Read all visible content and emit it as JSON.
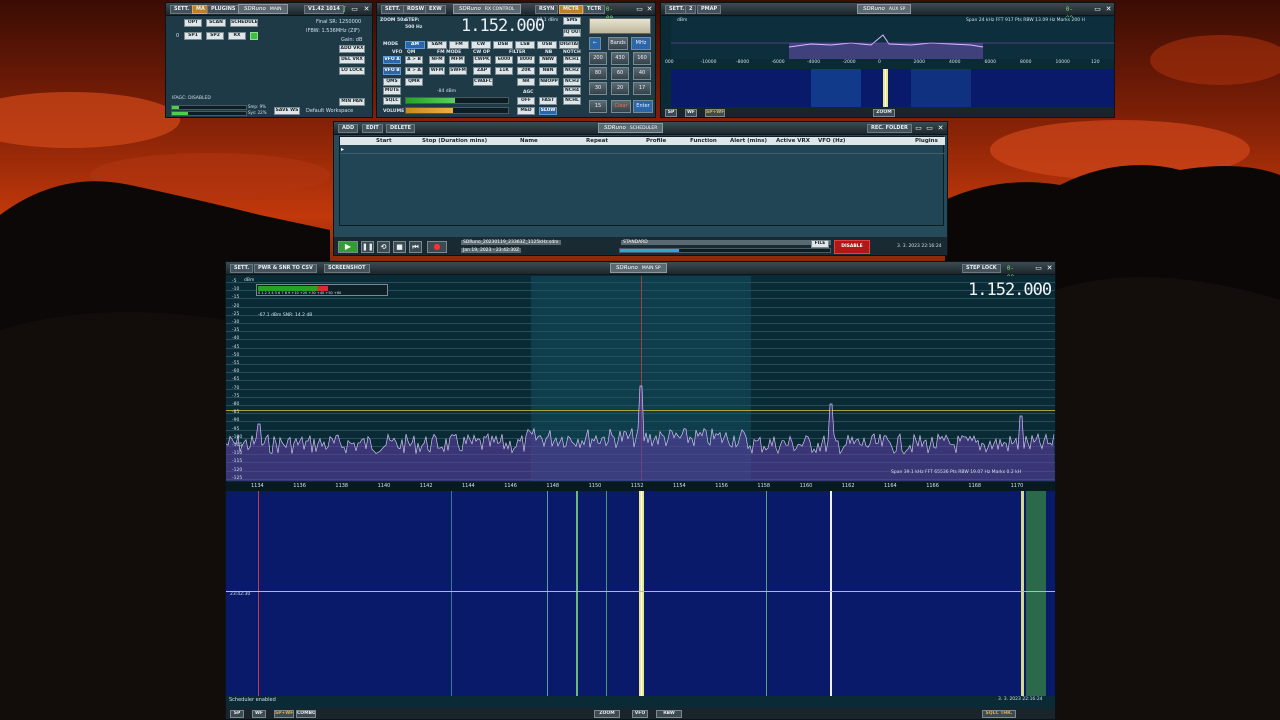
{
  "aux": {
    "sett": "SETT.",
    "b2": "2",
    "mpad": "PMAP",
    "title": "SDRuno",
    "subtitle": "AUX SP",
    "info": "Span 24 kHz   FFT 917 Pts   RBW 13.09 Hz   Marks 200 H",
    "dbm": "dBm",
    "xticks": [
      "000",
      "-10000",
      "-8000",
      "-6000",
      "-4000",
      "-2000",
      "0",
      "2000",
      "4000",
      "6000",
      "8000",
      "10000",
      "120"
    ],
    "sp": "SP",
    "wf": "WF",
    "spwf": "SP+WF",
    "zoom": "ZOOM"
  },
  "main": {
    "sett": "SETT.",
    "ma": "MA",
    "plugins": "PLUGINS",
    "title": "SDRuno",
    "subtitle": "MAIN",
    "version": "V1.42 1014",
    "final_sr": "Final SR:  1250000",
    "ifbw": "IFBW:  1.536MHz (ZIF)",
    "gain": "Gain: dB",
    "opt": "OPT",
    "scan": "SCAN",
    "scheduler": "SCHEDULER",
    "zero": "0",
    "sp1": "SP1",
    "sp2": "SP2",
    "rx": "RX",
    "add_vrx": "ADD VRX",
    "del_vrx": "DEL VRX",
    "lo_lock": "LO LOCK",
    "ifagc": "IFAGC: DISABLED",
    "smp": "Smp: 9%",
    "sys": "Sys: 22%",
    "save_ws": "SAVE WS",
    "workspace": "Default Workspace",
    "min_pan": "MIN PAN"
  },
  "rx": {
    "sett": "SETT.",
    "rdsw": "RDSW",
    "exw": "EXW",
    "title": "SDRuno",
    "subtitle": "RX CONTROL",
    "rsyn": "RSYN",
    "mctr": "MCTR",
    "tctr": "TCTR",
    "freq": "1.152.000",
    "step_label": "STEP:",
    "step_val": "500 Hz",
    "zoom_label": "ZOOM 50x",
    "dbm": "-67.1 dBm",
    "sms": "SMS",
    "iq_out": "IQ OUT",
    "mode_label": "MODE",
    "modes": [
      "AM",
      "SAM",
      "FM",
      "CW",
      "DSB",
      "LSB",
      "USB",
      "DIGITAL"
    ],
    "vfo": "VFO",
    "qm": "QM",
    "fm_mode": "FM MODE",
    "cw_op": "CW OP",
    "filter": "FILTER",
    "nb": "NB",
    "notch": "NOTCH",
    "vfoa": "VFO A",
    "ab": "A > B",
    "nfm": "NFM",
    "mfm": "MFM",
    "cwpk": "CWPK",
    "f6000": "6000",
    "b8000": "8000",
    "nbw": "NBW",
    "nch1": "NCH1",
    "vfob": "VFO B",
    "ba": "B > A",
    "wfm": "WFM",
    "swfm": "SWFM",
    "zap": "ZAP",
    "k11": "11K",
    "k20": "20K",
    "nbn": "NBN",
    "nch2": "NCH2",
    "qms": "QMS",
    "qmr": "QMR",
    "cwafc": "CWAFC",
    "nr": "NR",
    "nbopp": "NBOPP",
    "nch3": "NCH3",
    "mute": "MUTE",
    "agc": "AGC",
    "nch4": "NCH4",
    "sqlc": "SQLC",
    "off": "OFF",
    "fast": "FAST",
    "nchl": "NCHL",
    "volume": "VOLUME",
    "med": "MED",
    "slow": "SLOW",
    "sq_dbm": "-84 dBm"
  },
  "keypad": {
    "keys": [
      "Bands",
      "MHz",
      "200",
      "430",
      "160",
      "80",
      "60",
      "40",
      "30",
      "20",
      "17",
      "15",
      "Clear",
      "Enter"
    ]
  },
  "sched": {
    "add": "ADD",
    "edit": "EDIT",
    "delete": "DELETE",
    "title": "SDRuno",
    "subtitle": "SCHEDULER",
    "rec_folder": "REC. FOLDER",
    "cols": [
      "Start",
      "Stop (Duration mins)",
      "Name",
      "Repeat",
      "Profile",
      "Function",
      "Alert (mins)",
      "Active VRX",
      "VFO (Hz)",
      "Plugins"
    ],
    "file": "SDRuno_20230119_23363Z_1125kHz.sdrx",
    "file_time": "Jan 19, 2023 - 23:42:30Z",
    "standard": "STANDARD",
    "file_btn": "FILE",
    "disable": "DISABLE",
    "datetime": "3. 3. 2023 22:16:24"
  },
  "msp": {
    "sett": "SETT.",
    "pwr_snr": "PWR & SNR TO CSV",
    "screenshot": "SCREENSHOT",
    "title": "SDRuno",
    "subtitle": "MAIN SP",
    "step_lock": "STEP LOCK",
    "freq": "1.152.000",
    "dbm": "dBm",
    "meter_scale": "0 1 2 3 4 5 6 7 8 9 +10 +20 +30 +40 +50 +60",
    "level": "-67.1 dBm    SNR: 14.2 dB",
    "yticks": [
      "-5",
      "-10",
      "-15",
      "-20",
      "-25",
      "-30",
      "-35",
      "-40",
      "-45",
      "-50",
      "-55",
      "-60",
      "-65",
      "-70",
      "-75",
      "-80",
      "-85",
      "-90",
      "-95",
      "-100",
      "-105",
      "-110",
      "-115",
      "-120",
      "-125"
    ],
    "xticks": [
      "1134",
      "1136",
      "1138",
      "1140",
      "1142",
      "1144",
      "1146",
      "1148",
      "1150",
      "1152",
      "1154",
      "1156",
      "1158",
      "1160",
      "1162",
      "1164",
      "1166",
      "1168",
      "1170"
    ],
    "info": "Span 39.1 kHz   FFT 65536 Pts   RBW 19.07 Hz   Marks 0.2 kH",
    "wf_time": "23:42:30",
    "sched_enabled": "Scheduler enabled",
    "datetime": "3. 3. 2023 22:16:24",
    "sp": "SP",
    "wf": "WF",
    "spwf": "SP+WF",
    "combo": "COMBO",
    "zoom": "ZOOM",
    "vfo": "VFO",
    "rbw": "RBW",
    "sqlc_thr": "SQLC THR."
  }
}
